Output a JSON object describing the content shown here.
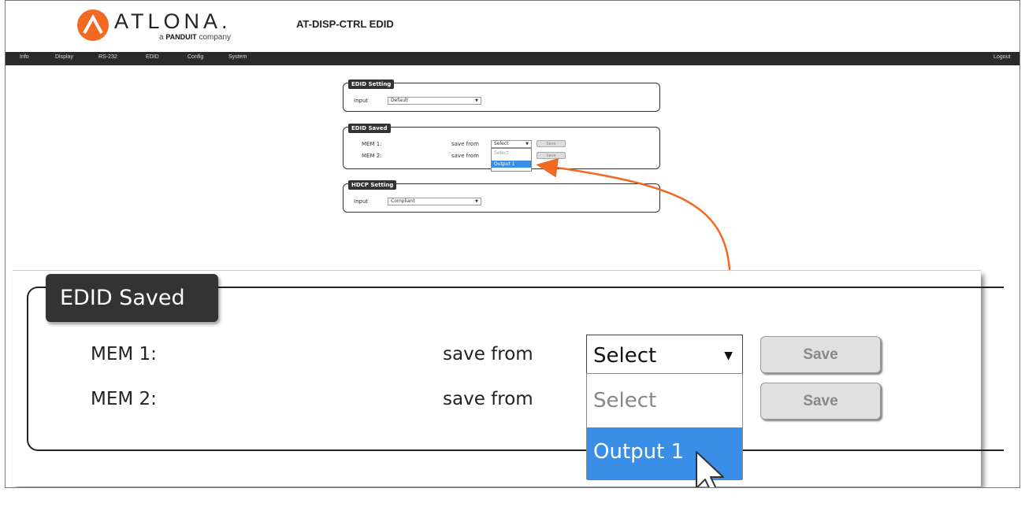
{
  "header": {
    "logo_text": "ATLONA.",
    "logo_sub_prefix": "a",
    "logo_sub_brand": "PANDUIT",
    "logo_sub_suffix": "company",
    "title": "AT-DISP-CTRL  EDID",
    "accent_color": "#f26a21"
  },
  "nav": {
    "items": [
      "Info",
      "Display",
      "RS-232",
      "EDID",
      "Config",
      "System"
    ],
    "logout": "Logout"
  },
  "edid_setting": {
    "legend": "EDID Setting",
    "input_label": "Input",
    "input_value": "Default"
  },
  "edid_saved": {
    "legend": "EDID Saved",
    "rows": [
      {
        "label": "MEM 1:",
        "save_from": "save from",
        "select_value": "Select",
        "button": "Save"
      },
      {
        "label": "MEM 2:",
        "save_from": "save from",
        "select_value": "Select",
        "button": "Save"
      }
    ],
    "dropdown_options": [
      "Select",
      "Output 1"
    ],
    "highlighted_option": "Output 1"
  },
  "hdcp_setting": {
    "legend": "HDCP Setting",
    "input_label": "Input",
    "input_value": "Compliant"
  },
  "icons": [
    "logo-mark-icon",
    "dropdown-arrow-icon",
    "mouse-cursor-icon"
  ]
}
